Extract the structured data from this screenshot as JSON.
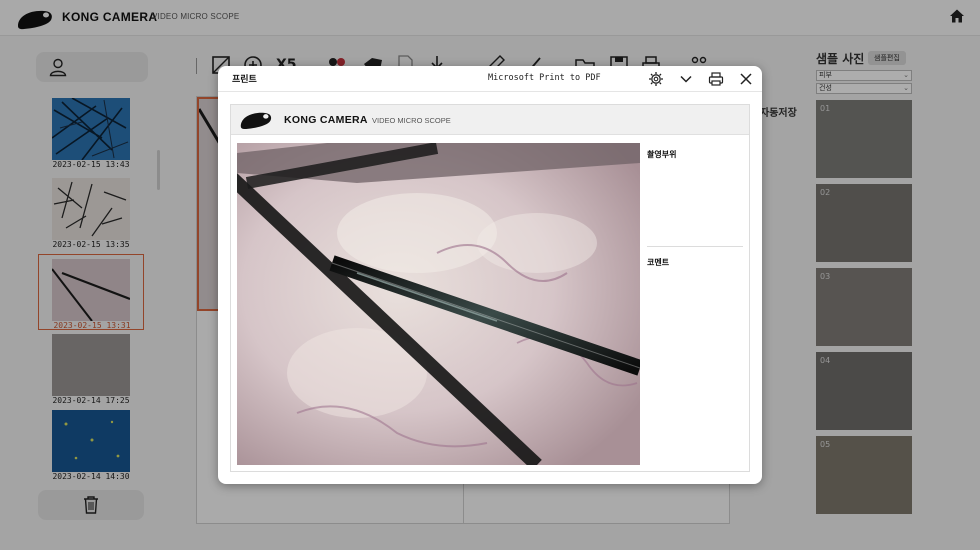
{
  "app": {
    "brand": "KONG CAMERA",
    "subtitle": "VIDEO MICRO SCOPE"
  },
  "thumbnails": [
    {
      "date": "2023-02-15 13:43",
      "selected": false
    },
    {
      "date": "2023-02-15 13:35",
      "selected": false
    },
    {
      "date": "2023-02-15 13:31",
      "selected": true
    },
    {
      "date": "2023-02-14 17:25",
      "selected": false
    },
    {
      "date": "2023-02-14 14:30",
      "selected": false
    }
  ],
  "toolbar": {
    "zoom_label": "X5"
  },
  "workspace": {
    "auto_save_label": "자동저장"
  },
  "sample_panel": {
    "title": "샘플 사진",
    "edit_button": "샘플편집",
    "select_1": "피부",
    "select_2": "건성",
    "items": [
      "01",
      "02",
      "03",
      "04",
      "05"
    ]
  },
  "print_dialog": {
    "title": "프린트",
    "printer_name": "Microsoft Print to PDF",
    "preview": {
      "brand": "KONG CAMERA",
      "subtitle": "VIDEO MICRO SCOPE",
      "area_label": "촬영부위",
      "comment_label": "코멘트"
    }
  },
  "colors": {
    "accent": "#d9663f",
    "overlay": "rgba(0,0,0,0.32)"
  }
}
